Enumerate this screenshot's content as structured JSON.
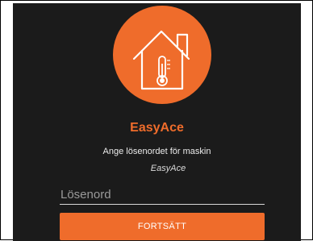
{
  "app": {
    "name": "EasyAce",
    "logo_icon": "house-thermometer-icon"
  },
  "login": {
    "prompt": "Ange lösenordet för maskin",
    "machine_name": "EasyAce",
    "password": {
      "value": "",
      "placeholder": "Lösenord"
    },
    "continue_label": "FORTSÄTT"
  },
  "colors": {
    "accent": "#ef6c2b",
    "background": "#1b1b1b"
  }
}
